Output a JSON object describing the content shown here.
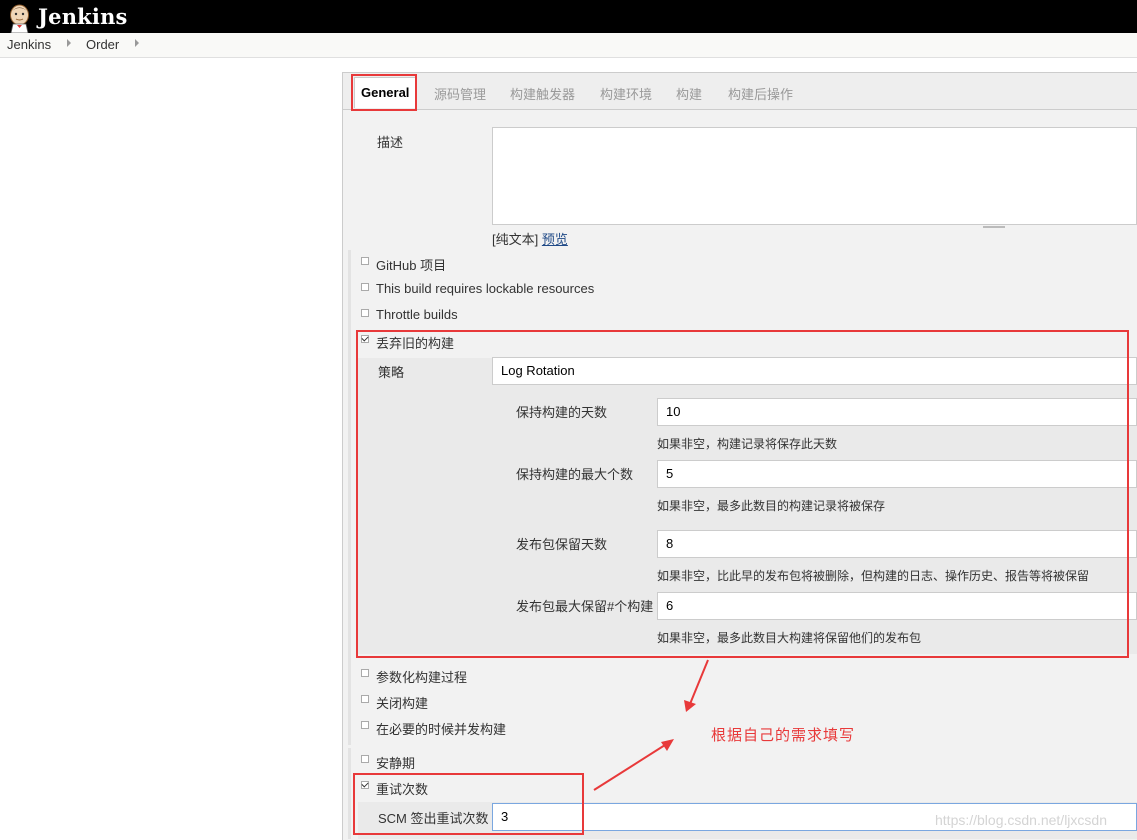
{
  "header": {
    "title": "Jenkins",
    "logo_icon": "jenkins-butler-icon"
  },
  "breadcrumb": [
    "Jenkins",
    "Order"
  ],
  "tabs": [
    "General",
    "源码管理",
    "构建触发器",
    "构建环境",
    "构建",
    "构建后操作"
  ],
  "description": {
    "label": "描述",
    "plain_text": "[纯文本]",
    "preview": "预览"
  },
  "options": {
    "github": "GitHub 项目",
    "lockable": "This build requires lockable resources",
    "throttle": "Throttle builds",
    "discard_old": "丢弃旧的构建",
    "parameterized": "参数化构建过程",
    "disable": "关闭构建",
    "concurrent": "在必要的时候并发构建",
    "quiet_period": "安静期",
    "retry_count": "重试次数"
  },
  "discard": {
    "strategy_label": "策略",
    "strategy_value": "Log Rotation",
    "days_label": "保持构建的天数",
    "days_value": "10",
    "days_help": "如果非空，构建记录将保存此天数",
    "max_label": "保持构建的最大个数",
    "max_value": "5",
    "max_help": "如果非空，最多此数目的构建记录将被保存",
    "artifact_days_label": "发布包保留天数",
    "artifact_days_value": "8",
    "artifact_days_help": "如果非空，比此早的发布包将被删除，但构建的日志、操作历史、报告等将被保留",
    "artifact_max_label": "发布包最大保留#个构建",
    "artifact_max_value": "6",
    "artifact_max_help": "如果非空，最多此数目大构建将保留他们的发布包"
  },
  "scm_retry": {
    "label": "SCM 签出重试次数",
    "value": "3"
  },
  "annotation": "根据自己的需求填写",
  "watermark": "https://blog.csdn.net/ljxcsdn",
  "colors": {
    "header_bg": "#000000",
    "highlight": "#e8393a",
    "link": "#204a87"
  },
  "checkbox_states": {
    "discard_old": true,
    "retry_count": true
  }
}
